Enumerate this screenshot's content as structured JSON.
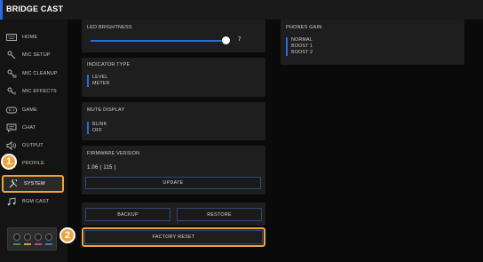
{
  "app": {
    "title": "BRIDGE CAST"
  },
  "sidebar": {
    "items": [
      {
        "label": "HOME",
        "icon": "keyboard-icon"
      },
      {
        "label": "MIC SETUP",
        "icon": "mic-setup-icon"
      },
      {
        "label": "MIC CLEANUP",
        "icon": "mic-cleanup-icon"
      },
      {
        "label": "MIC EFFECTS",
        "icon": "mic-effects-icon"
      },
      {
        "label": "GAME",
        "icon": "gamepad-icon"
      },
      {
        "label": "CHAT",
        "icon": "chat-icon"
      },
      {
        "label": "OUTPUT",
        "icon": "speaker-icon"
      },
      {
        "label": "PROFILE",
        "icon": "profile-icon"
      },
      {
        "label": "SYSTEM",
        "icon": "wrench-icon"
      },
      {
        "label": "BGM CAST",
        "icon": "music-note-icon"
      }
    ],
    "active_index": 8
  },
  "callouts": {
    "one": "1",
    "two": "2"
  },
  "led_brightness": {
    "label": "LED BRIGHTNESS",
    "value": "7"
  },
  "indicator_type": {
    "label": "INDICATOR TYPE",
    "options": [
      "LEVEL",
      "METER"
    ]
  },
  "mute_display": {
    "label": "MUTE DISPLAY",
    "options": [
      "BLINK",
      "OFF"
    ]
  },
  "firmware": {
    "label": "FIRMWARE VERSION",
    "version": "1.06 ( 115 )",
    "update_label": "UPDATE"
  },
  "actions": {
    "backup_label": "BACKUP",
    "restore_label": "RESTORE",
    "factory_reset_label": "FACTORY RESET"
  },
  "phones_gain": {
    "label": "PHONES GAIN",
    "options": [
      "NORMAL",
      "BOOST 1",
      "BOOST 2"
    ]
  },
  "colors": {
    "accent": "#2a6be0",
    "highlight": "#f0a33a"
  }
}
